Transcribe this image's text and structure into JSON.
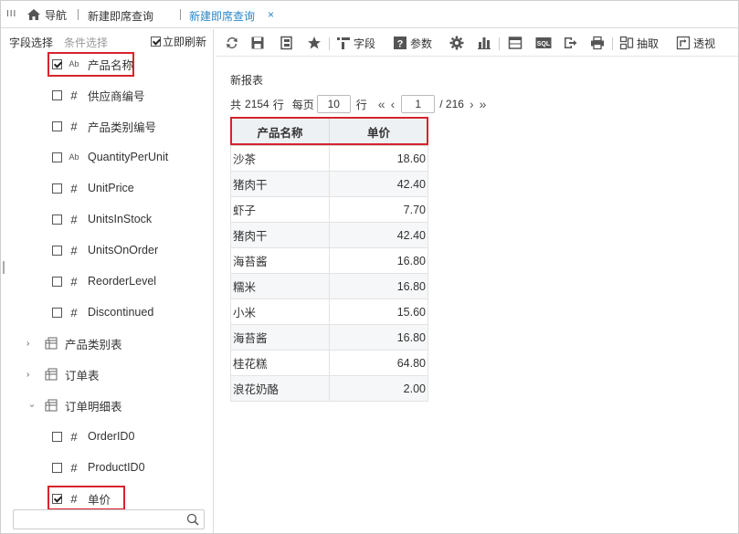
{
  "tabbar": {
    "nav_label": "导航",
    "tabs": [
      {
        "label": "新建即席查询",
        "active": false
      },
      {
        "label": "新建即席查询",
        "active": true
      }
    ],
    "close_glyph": "×"
  },
  "left_panel": {
    "tabs": [
      "字段选择",
      "条件选择"
    ],
    "auto_refresh_label": "立即刷新",
    "auto_refresh_checked": true,
    "fields": [
      {
        "label": "产品名称",
        "type": "text",
        "checked": true
      },
      {
        "label": "供应商编号",
        "type": "number",
        "checked": false
      },
      {
        "label": "产品类别编号",
        "type": "number",
        "checked": false
      },
      {
        "label": "QuantityPerUnit",
        "type": "text",
        "checked": false
      },
      {
        "label": "UnitPrice",
        "type": "number",
        "checked": false
      },
      {
        "label": "UnitsInStock",
        "type": "number",
        "checked": false
      },
      {
        "label": "UnitsOnOrder",
        "type": "number",
        "checked": false
      },
      {
        "label": "ReorderLevel",
        "type": "number",
        "checked": false
      },
      {
        "label": "Discontinued",
        "type": "number",
        "checked": false
      }
    ],
    "tables": [
      {
        "label": "产品类别表",
        "expanded": false
      },
      {
        "label": "订单表",
        "expanded": false
      },
      {
        "label": "订单明细表",
        "expanded": true
      }
    ],
    "detail_fields": [
      {
        "label": "OrderID0",
        "type": "number",
        "checked": false
      },
      {
        "label": "ProductID0",
        "type": "number",
        "checked": false
      },
      {
        "label": "单价",
        "type": "number",
        "checked": true
      }
    ],
    "type_glyphs": {
      "number": "#",
      "text": "Ab"
    },
    "search_placeholder": ""
  },
  "toolbar": {
    "field_label": "字段",
    "param_label": "参数",
    "extract_label": "抽取",
    "pivot_label": "透视",
    "sql_label": "SQL"
  },
  "report": {
    "title": "新报表",
    "pager": {
      "total_prefix": "共",
      "total_rows": "2154",
      "total_suffix": "行",
      "per_page_label": "每页",
      "per_page": "10",
      "rows_suffix": "行",
      "current_page": "1",
      "total_pages": "/ 216"
    },
    "columns": [
      "产品名称",
      "单价"
    ],
    "rows": [
      [
        "沙茶",
        "18.60"
      ],
      [
        "猪肉干",
        "42.40"
      ],
      [
        "虾子",
        "7.70"
      ],
      [
        "猪肉干",
        "42.40"
      ],
      [
        "海苔酱",
        "16.80"
      ],
      [
        "糯米",
        "16.80"
      ],
      [
        "小米",
        "15.60"
      ],
      [
        "海苔酱",
        "16.80"
      ],
      [
        "桂花糕",
        "64.80"
      ],
      [
        "浪花奶酪",
        "2.00"
      ]
    ]
  },
  "colors": {
    "accent": "#2a87c8",
    "highlight": "#d7232c",
    "header_bg": "#eef1f4",
    "stripe_bg": "#f5f7f8"
  }
}
